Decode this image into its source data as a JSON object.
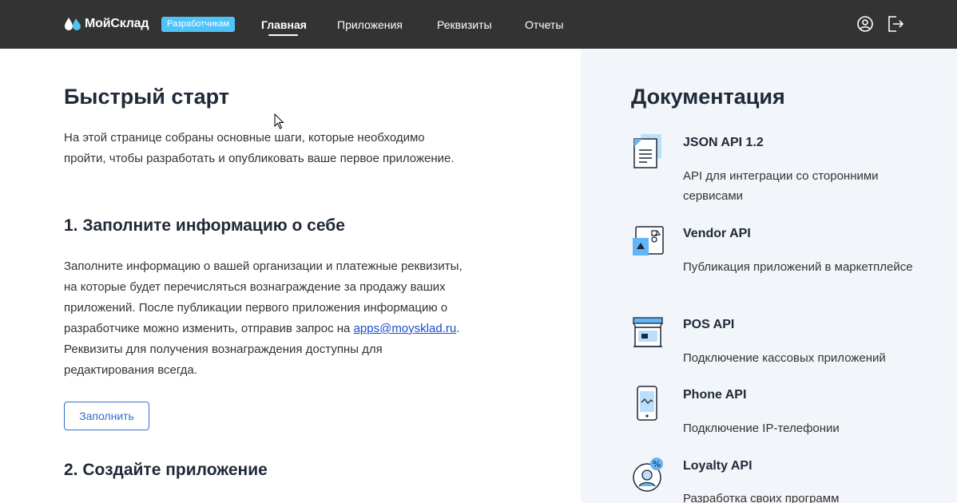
{
  "header": {
    "brand": "МойСклад",
    "badge": "Разработчикам",
    "nav": [
      "Главная",
      "Приложения",
      "Реквизиты",
      "Отчеты"
    ],
    "active_nav": "Главная",
    "icons": [
      "user-icon",
      "logout-icon"
    ]
  },
  "main": {
    "title": "Быстрый старт",
    "intro": "На этой странице собраны основные шаги, которые необходимо пройти, чтобы разработать и опубликовать ваше первое приложение.",
    "step1": {
      "title": "1. Заполните информацию о себе",
      "text_before": "Заполните информацию о вашей организации и платежные реквизиты, на которые будет перечисляться вознаграждение за продажу ваших приложений. После публикации первого приложения информацию о разработчике можно изменить, отправив запрос на ",
      "email": "apps@moysklad.ru",
      "text_after": ". Реквизиты для получения вознаграждения доступны для редактирования всегда.",
      "button": "Заполнить"
    },
    "step2": {
      "title": "2. Создайте приложение"
    }
  },
  "docs": {
    "title": "Документация",
    "items": [
      {
        "name": "JSON API 1.2",
        "desc": "API для интеграции со сторонними сервисами",
        "icon": "document-icon"
      },
      {
        "name": "Vendor API",
        "desc": "Публикация приложений в маркетплейсе",
        "icon": "marketplace-icon"
      },
      {
        "name": "POS API",
        "desc": "Подключение кассовых приложений",
        "icon": "store-icon"
      },
      {
        "name": "Phone API",
        "desc": "Подключение IP-телефонии",
        "icon": "phone-icon"
      },
      {
        "name": "Loyalty API",
        "desc": "Разработка своих программ",
        "icon": "loyalty-icon"
      }
    ]
  },
  "colors": {
    "topbar": "#333333",
    "badge": "#4fc3f7",
    "accent": "#2f6fc9",
    "docs_bg": "#f2f5f9",
    "icon_blue": "#64b5f6"
  }
}
